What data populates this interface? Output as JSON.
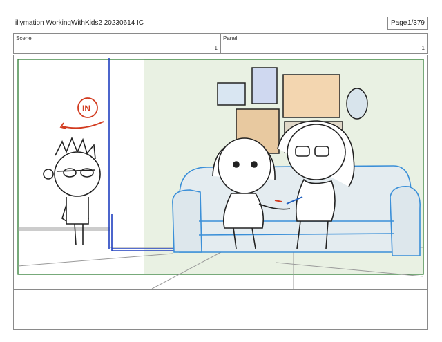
{
  "header": {
    "title": "illymation WorkingWithKids2 20230614 IC",
    "page_label": "Page",
    "page_value": "1/379"
  },
  "scene": {
    "label": "Scene",
    "value": "1"
  },
  "panel": {
    "label": "Panel",
    "value": "1"
  },
  "annotation": {
    "text": "IN"
  },
  "colors": {
    "frame_green": "#2e7d32",
    "door_blue": "#1f3fbf",
    "sofa_blue": "#3a8fd8",
    "annotation_red": "#d23a1e",
    "wall_tint": "#e8f0e0"
  },
  "notes": {
    "text": ""
  }
}
